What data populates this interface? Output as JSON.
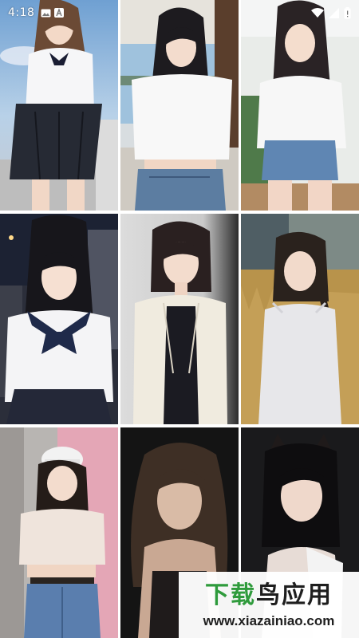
{
  "status_bar": {
    "time": "4:18",
    "left_icons": [
      "image-icon",
      "font-icon"
    ],
    "right_icons": [
      "wifi-icon",
      "signal-icon",
      "battery-icon"
    ]
  },
  "gallery": {
    "photos": [
      {
        "name": "photo-schoolgirl-uniform-skirt"
      },
      {
        "name": "photo-white-crop-top-window"
      },
      {
        "name": "photo-braid-denim-shorts"
      },
      {
        "name": "photo-sailor-uniform-street-night"
      },
      {
        "name": "photo-bob-cream-cardigan"
      },
      {
        "name": "photo-braid-wheat-field"
      },
      {
        "name": "photo-white-cap-jeans"
      },
      {
        "name": "photo-dark-portrait-wavy-hair"
      },
      {
        "name": "photo-cat-ears-dark-portrait"
      }
    ]
  },
  "watermark": {
    "logo_green": "下载",
    "logo_dark": "鸟应用",
    "url": "www.xiazainiao.com"
  }
}
